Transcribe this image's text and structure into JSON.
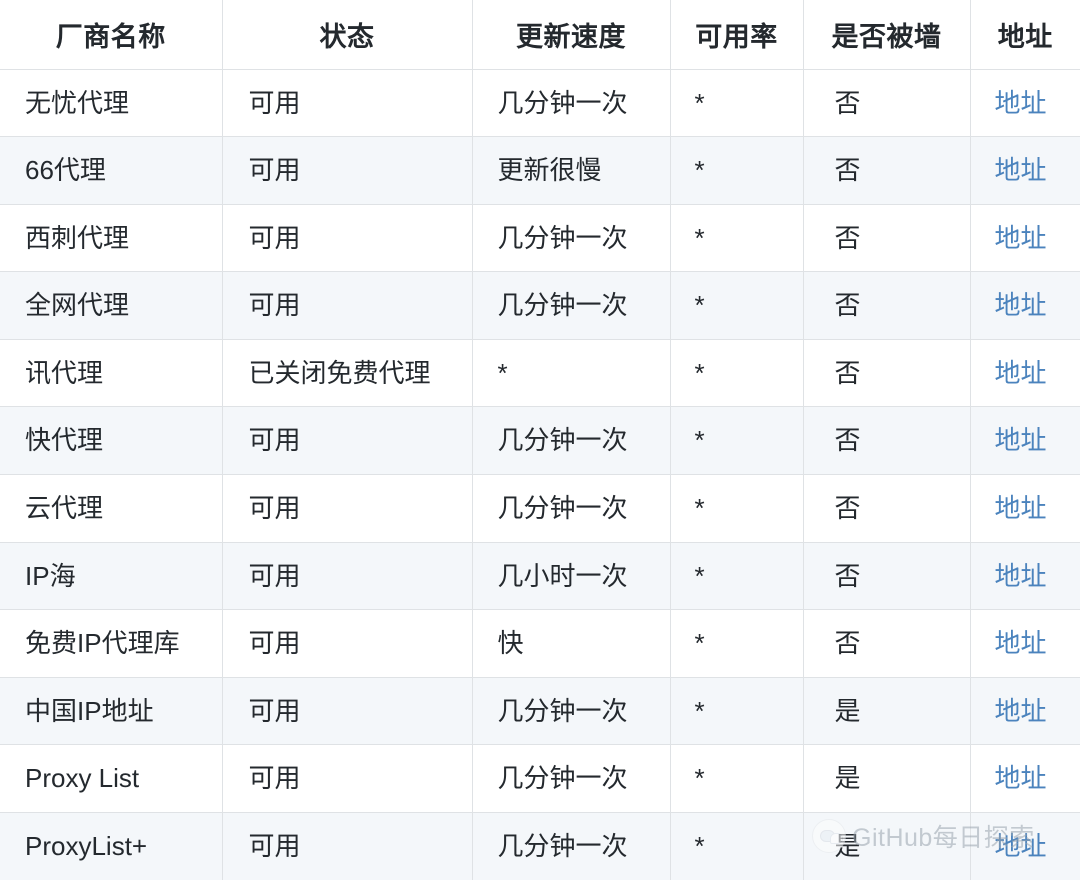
{
  "table": {
    "columns": [
      {
        "key": "vendor",
        "label": "厂商名称"
      },
      {
        "key": "status",
        "label": "状态"
      },
      {
        "key": "speed",
        "label": "更新速度"
      },
      {
        "key": "rate",
        "label": "可用率"
      },
      {
        "key": "wall",
        "label": "是否被墙"
      },
      {
        "key": "link",
        "label": "地址"
      }
    ],
    "rows": [
      {
        "vendor": "无忧代理",
        "status": "可用",
        "speed": "几分钟一次",
        "rate": "*",
        "wall": "否",
        "link": "地址"
      },
      {
        "vendor": "66代理",
        "status": "可用",
        "speed": "更新很慢",
        "rate": "*",
        "wall": "否",
        "link": "地址"
      },
      {
        "vendor": "西刺代理",
        "status": "可用",
        "speed": "几分钟一次",
        "rate": "*",
        "wall": "否",
        "link": "地址"
      },
      {
        "vendor": "全网代理",
        "status": "可用",
        "speed": "几分钟一次",
        "rate": "*",
        "wall": "否",
        "link": "地址"
      },
      {
        "vendor": "讯代理",
        "status": "已关闭免费代理",
        "speed": "*",
        "rate": "*",
        "wall": "否",
        "link": "地址"
      },
      {
        "vendor": "快代理",
        "status": "可用",
        "speed": "几分钟一次",
        "rate": "*",
        "wall": "否",
        "link": "地址"
      },
      {
        "vendor": "云代理",
        "status": "可用",
        "speed": "几分钟一次",
        "rate": "*",
        "wall": "否",
        "link": "地址"
      },
      {
        "vendor": "IP海",
        "status": "可用",
        "speed": "几小时一次",
        "rate": "*",
        "wall": "否",
        "link": "地址"
      },
      {
        "vendor": "免费IP代理库",
        "status": "可用",
        "speed": "快",
        "rate": "*",
        "wall": "否",
        "link": "地址"
      },
      {
        "vendor": "中国IP地址",
        "status": "可用",
        "speed": "几分钟一次",
        "rate": "*",
        "wall": "是",
        "link": "地址"
      },
      {
        "vendor": "Proxy List",
        "status": "可用",
        "speed": "几分钟一次",
        "rate": "*",
        "wall": "是",
        "link": "地址"
      },
      {
        "vendor": "ProxyList+",
        "status": "可用",
        "speed": "几分钟一次",
        "rate": "*",
        "wall": "是",
        "link": "地址"
      }
    ]
  },
  "watermark": {
    "text": "GitHub每日探索",
    "icon": "chat-bubbles-logo-icon"
  },
  "colors": {
    "link": "#4b83bd",
    "border": "#dfe2e5",
    "row_alt_bg": "#f4f7fa",
    "row_bg": "#ffffff",
    "text": "#24292e",
    "watermark_text": "#9aa4ae"
  }
}
